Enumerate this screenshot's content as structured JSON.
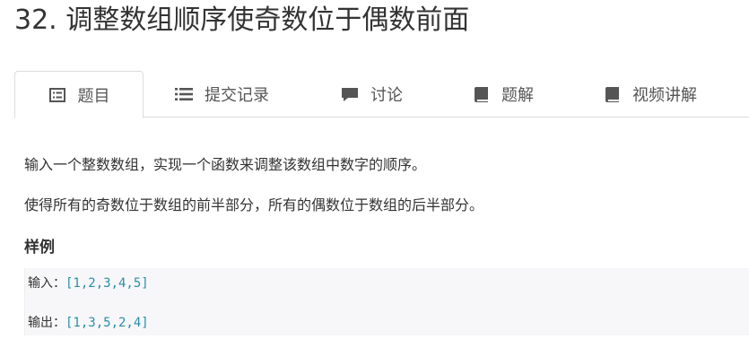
{
  "problem": {
    "title": "32. 调整数组顺序使奇数位于偶数前面"
  },
  "tabs": [
    {
      "label": "题目",
      "icon": "list-box-icon",
      "active": true
    },
    {
      "label": "提交记录",
      "icon": "list-lines-icon",
      "active": false
    },
    {
      "label": "讨论",
      "icon": "comment-icon",
      "active": false
    },
    {
      "label": "题解",
      "icon": "book-icon",
      "active": false
    },
    {
      "label": "视频讲解",
      "icon": "book-icon",
      "active": false
    }
  ],
  "description": {
    "line1": "输入一个整数数组，实现一个函数来调整该数组中数字的顺序。",
    "line2": "使得所有的奇数位于数组的前半部分，所有的偶数位于数组的后半部分。"
  },
  "sample": {
    "heading": "样例",
    "input_label": "输入：",
    "input_value": "[1,2,3,4,5]",
    "output_label": "输出：",
    "output_value": "[1,3,5,2,4]"
  },
  "colors": {
    "text": "#333333",
    "tab_text": "#555555",
    "border": "#dddddd",
    "code_bg": "#f7f7f9",
    "code_value": "#2a8ea8"
  }
}
